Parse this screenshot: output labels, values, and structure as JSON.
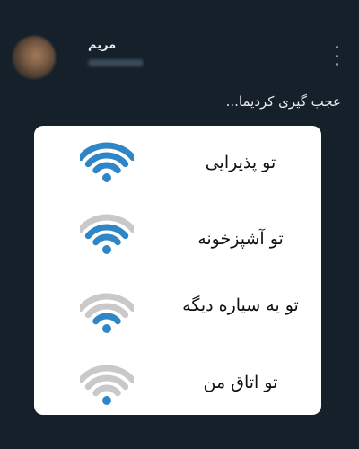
{
  "post": {
    "author_name": "مریم",
    "text": "عجب گیری کردیما..."
  },
  "colors": {
    "background": "#15202b",
    "wifi_active": "#2f86c7",
    "wifi_inactive": "#c9c9c9"
  },
  "meme": {
    "rows": [
      {
        "label": "تو پذیرایی",
        "signal_bars": 4,
        "icon": "wifi-full-icon"
      },
      {
        "label": "تو آشپزخونه",
        "signal_bars": 3,
        "icon": "wifi-three-bars-icon"
      },
      {
        "label": "تو یه سیاره دیگه",
        "signal_bars": 2,
        "icon": "wifi-two-bars-icon"
      },
      {
        "label": "تو اتاق من",
        "signal_bars": 1,
        "icon": "wifi-one-bar-icon"
      }
    ]
  }
}
